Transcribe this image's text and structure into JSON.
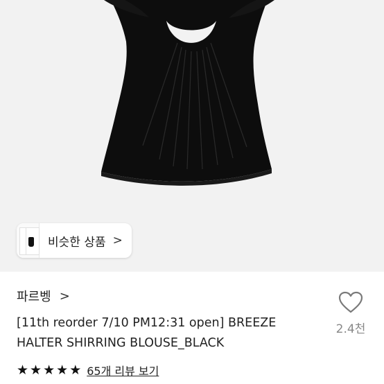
{
  "similar": {
    "label": "비슷한 상품",
    "chevron": ">"
  },
  "shop": {
    "name": "파르벵",
    "chevron": ">"
  },
  "product": {
    "title_line1": "[11th reorder 7/10 PM12:31 open] BREEZE",
    "title_line2": "HALTER SHIRRING BLOUSE_BLACK"
  },
  "like": {
    "icon": "heart-outline-icon",
    "count": "2.4천"
  },
  "rating": {
    "stars": 5,
    "star_glyph": "★",
    "review_link": "65개 리뷰 보기"
  },
  "colors": {
    "hero_bg": "#f2f2f2",
    "garment": "#0d0d0d",
    "text": "#222222",
    "muted": "#888888"
  }
}
